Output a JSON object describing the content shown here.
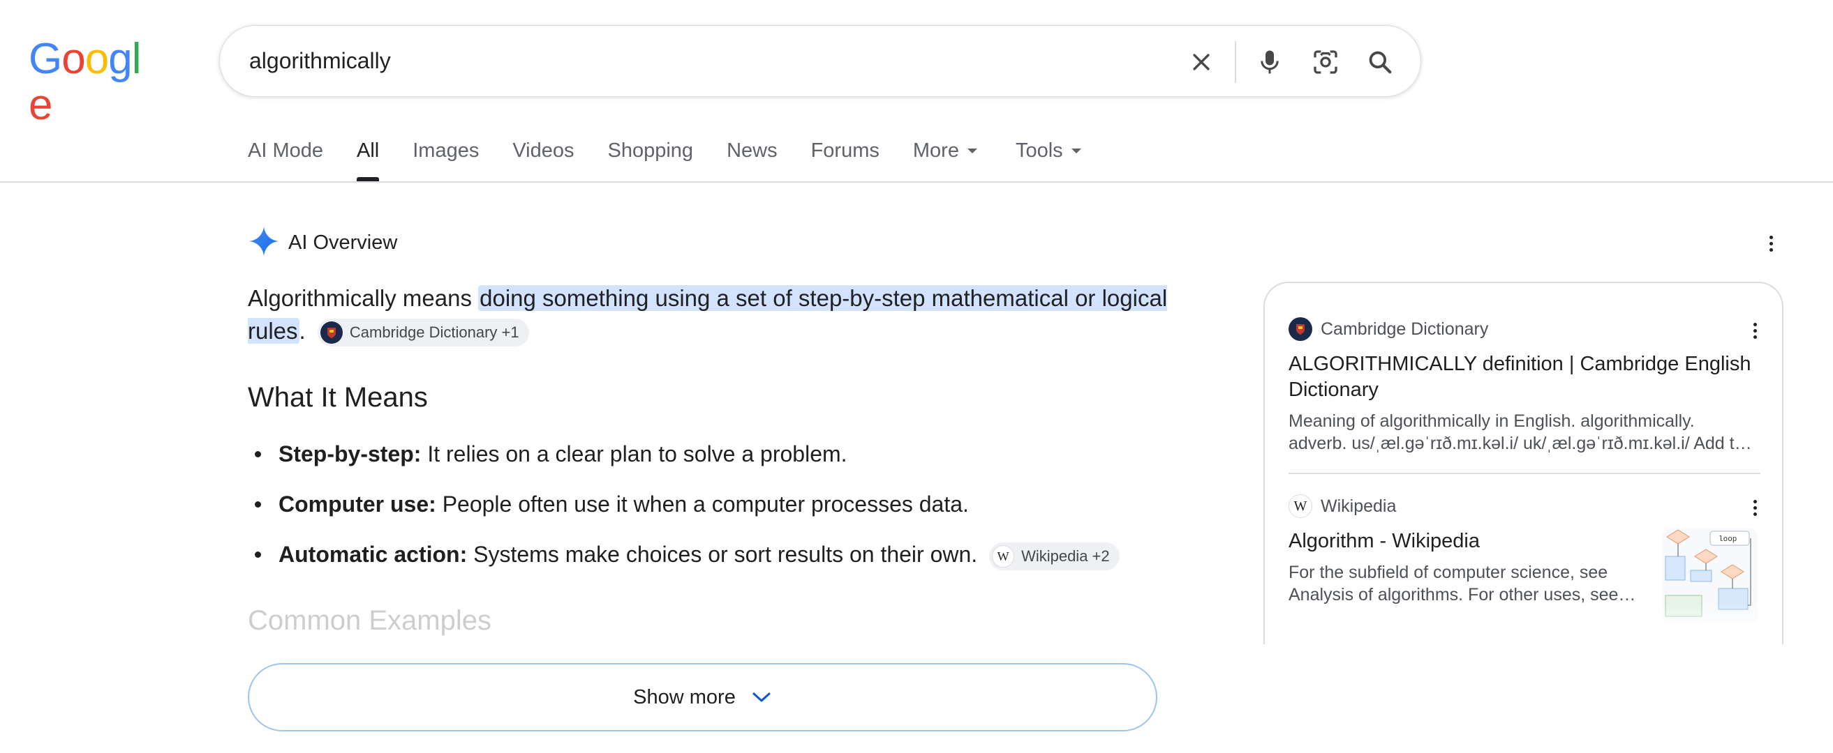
{
  "logo": {
    "text": "Google",
    "letters": [
      "G",
      "o",
      "o",
      "g",
      "l",
      "e"
    ],
    "colors": [
      "#4285F4",
      "#EA4335",
      "#FBBC05",
      "#4285F4",
      "#34A853",
      "#EA4335"
    ]
  },
  "search": {
    "query": "algorithmically",
    "icons": [
      "close-icon",
      "mic-icon",
      "lens-icon",
      "search-icon"
    ]
  },
  "tabs": [
    {
      "label": "AI Mode"
    },
    {
      "label": "All",
      "active": true
    },
    {
      "label": "Images"
    },
    {
      "label": "Videos"
    },
    {
      "label": "Shopping"
    },
    {
      "label": "News"
    },
    {
      "label": "Forums"
    },
    {
      "label": "More",
      "caret": true
    },
    {
      "label": "Tools",
      "caret": true
    }
  ],
  "ai_overview": {
    "title": "AI Overview",
    "intro_prefix": "Algorithmically means ",
    "intro_highlight": "doing something using a set of step-by-step mathematical or logical rules",
    "intro_suffix": ".",
    "intro_chip": "Cambridge Dictionary +1",
    "section_heading": "What It Means",
    "bullets": [
      {
        "term": "Step-by-step:",
        "text": " It relies on a clear plan to solve a problem."
      },
      {
        "term": "Computer use:",
        "text": " People often use it when a computer processes data."
      },
      {
        "term": "Automatic action:",
        "text": " Systems make choices or sort results on their own.",
        "chip": "Wikipedia +2"
      }
    ],
    "faded_heading": "Common Examples",
    "show_more": "Show more"
  },
  "sources": [
    {
      "site": "Cambridge Dictionary",
      "title": "ALGORITHMICALLY definition | Cambridge English Dictionary",
      "desc_line1": "Meaning of algorithmically in English. algorithmically.",
      "desc_line2": "adverb. us/ˌæl.ɡəˈrɪð.mɪ.kəl.i/ uk/ˌæl.ɡəˈrɪð.mɪ.kəl.i/ Add t…"
    },
    {
      "site": "Wikipedia",
      "title": "Algorithm - Wikipedia",
      "desc_line1": "For the subfield of computer science, see",
      "desc_line2": "Analysis of algorithms. For other uses, see…",
      "thumb_label": "loop"
    }
  ],
  "colors": {
    "highlight": "#d3e3fd",
    "chip_bg": "#eef0f3",
    "border": "#dadce0",
    "show_more_border": "#9ec2f2"
  }
}
